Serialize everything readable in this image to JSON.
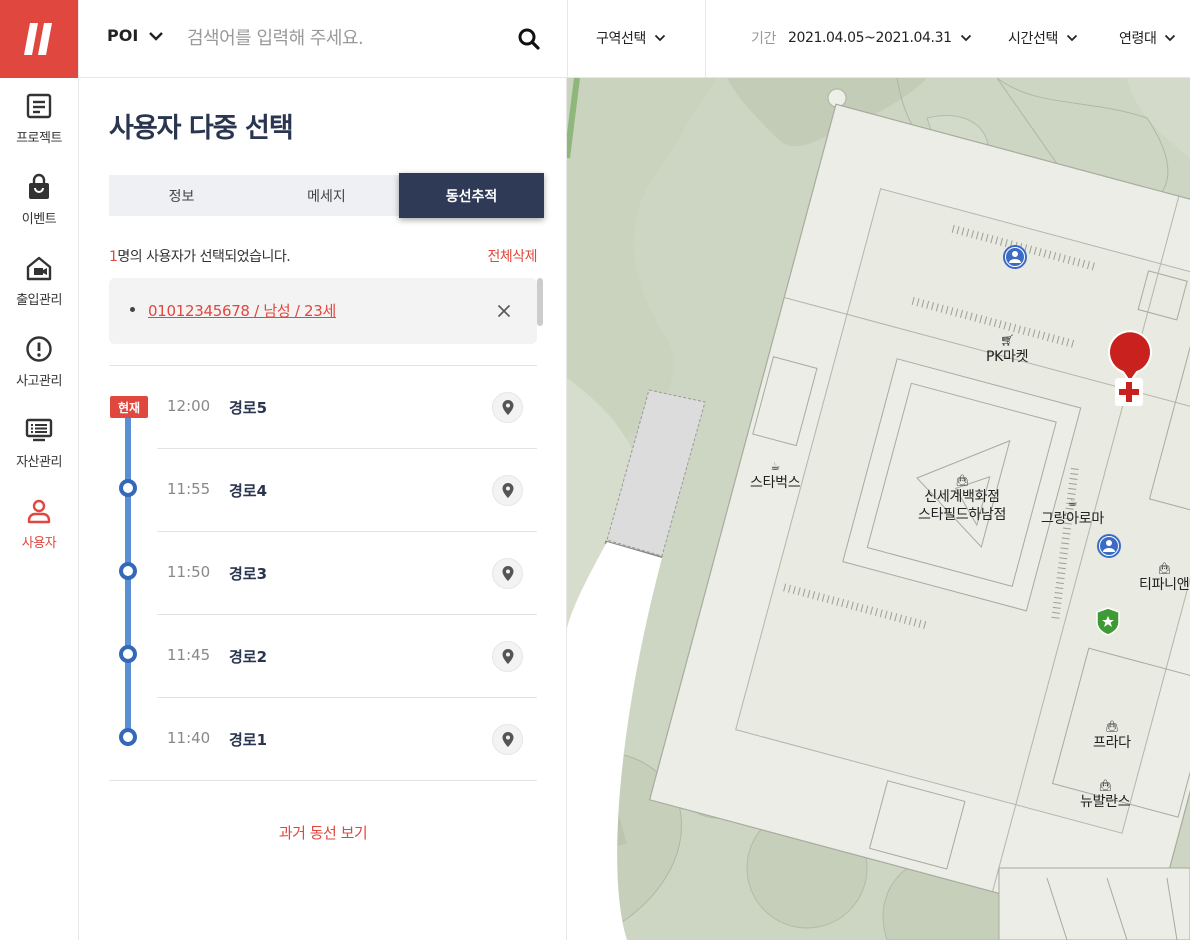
{
  "nav": {
    "items": [
      {
        "label": "프로젝트",
        "icon": "document-icon"
      },
      {
        "label": "이벤트",
        "icon": "shopping-bag-icon"
      },
      {
        "label": "출입관리",
        "icon": "home-camera-icon"
      },
      {
        "label": "사고관리",
        "icon": "alert-circle-icon"
      },
      {
        "label": "자산관리",
        "icon": "monitor-icon"
      },
      {
        "label": "사용자",
        "icon": "user-icon",
        "active": true
      }
    ]
  },
  "topbar": {
    "poi_label": "POI",
    "search_placeholder": "검색어를 입력해 주세요.",
    "zone_label": "구역선택",
    "period_label": "기간",
    "period_value": "2021.04.05~2021.04.31",
    "time_label": "시간선택",
    "age_label": "연령대"
  },
  "panel": {
    "title": "사용자 다중 선택",
    "tabs": [
      {
        "label": "정보"
      },
      {
        "label": "메세지"
      },
      {
        "label": "동선추적",
        "active": true
      }
    ],
    "selected_count": "1",
    "selected_text": "명의 사용자가 선택되었습니다.",
    "clear_all": "전체삭제",
    "selected_user": "01012345678 / 남성 / 23세",
    "now_badge": "현재",
    "routes": [
      {
        "time": "12:00",
        "name": "경로5"
      },
      {
        "time": "11:55",
        "name": "경로4"
      },
      {
        "time": "11:50",
        "name": "경로3"
      },
      {
        "time": "11:45",
        "name": "경로2"
      },
      {
        "time": "11:40",
        "name": "경로1"
      }
    ],
    "past_routes": "과거 동선 보기"
  },
  "map": {
    "pois": [
      {
        "label": "PK마켓",
        "icon": "cart-icon"
      },
      {
        "label": "스타벅스",
        "icon": "coffee-icon"
      },
      {
        "label": "신세계백화점\n스타필드하남점",
        "icon": "shopping-bag-icon"
      },
      {
        "label": "그랑아로마",
        "icon": "coffee-icon"
      },
      {
        "label": "티파니앤",
        "icon": "shopping-bag-icon"
      },
      {
        "label": "프라다",
        "icon": "shopping-bag-icon"
      },
      {
        "label": "뉴발란스",
        "icon": "shopping-bag-icon"
      }
    ],
    "colors": {
      "grass": "#cdd6c3",
      "building": "#ecede6",
      "accent": "#e0473f"
    }
  }
}
